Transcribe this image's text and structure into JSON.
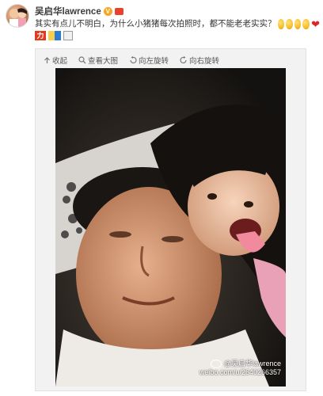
{
  "post": {
    "username": "吴启华lawrence",
    "text": "其实有点儿不明白，为什么小猪猪每次拍照时，都不能老老实实？",
    "emoji_icons": [
      "smile-icon",
      "laugh-icon",
      "wink-icon",
      "tongue-icon"
    ],
    "heart_icon": "heart-icon"
  },
  "badges": {
    "li_label": "力"
  },
  "toolbar": {
    "collapse_label": "收起",
    "view_large_label": "查看大图",
    "rotate_left_label": "向左旋转",
    "rotate_right_label": "向右旋转"
  },
  "photo": {
    "watermark_handle": "@吴启华lawrence",
    "watermark_url": "weibo.com/u/2640266357"
  },
  "colors": {
    "username": "#3c3c3c",
    "text": "#333333",
    "accent_verified": "#f6a623",
    "heart": "#e0242a"
  }
}
